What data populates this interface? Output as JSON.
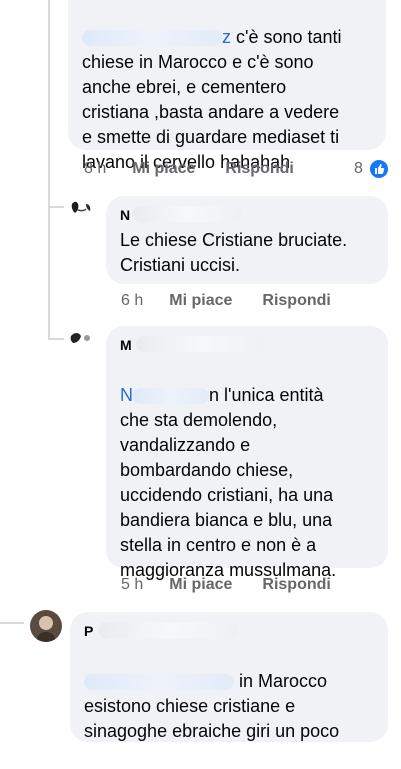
{
  "comments": [
    {
      "mention_suffix": "z",
      "text_first": " c'è sono tanti",
      "text_rest": "chiese in Marocco e c'è sono\nanche ebrei, e cementero\ncristiana ,basta andare a vedere\ne smette di guardare mediaset ti\nlavano il cervello hahahah",
      "time": "8 h",
      "like": "Mi piace",
      "reply": "Rispondi",
      "reaction_count": "8"
    },
    {
      "name_stub": "N",
      "text": "Le chiese Cristiane bruciate.\nCristiani uccisi.",
      "time": "6 h",
      "like": "Mi piace",
      "reply": "Rispondi"
    },
    {
      "name_stub": "M",
      "mention_stub": "N",
      "text_first": "n l'unica entità",
      "text_rest": "che sta demolendo,\nvandalizzando e\nbombardando chiese,\nuccidendo cristiani, ha una\nbandiera bianca e blu, una\nstella in centro e non è a\nmaggioranza mussulmana.",
      "time": "5 h",
      "like": "Mi piace",
      "reply": "Rispondi"
    },
    {
      "name_stub": "P",
      "text_first": " in Marocco",
      "text_rest": "esistono chiese cristiane e\nsinagoghe ebraiche  giri un poco"
    }
  ],
  "icons": {
    "like_badge": "thumbs-up-icon"
  },
  "colors": {
    "bubble": "#f0f2f5",
    "meta": "#65676b",
    "mention": "#216fdb",
    "like_blue": "#1877f2"
  }
}
